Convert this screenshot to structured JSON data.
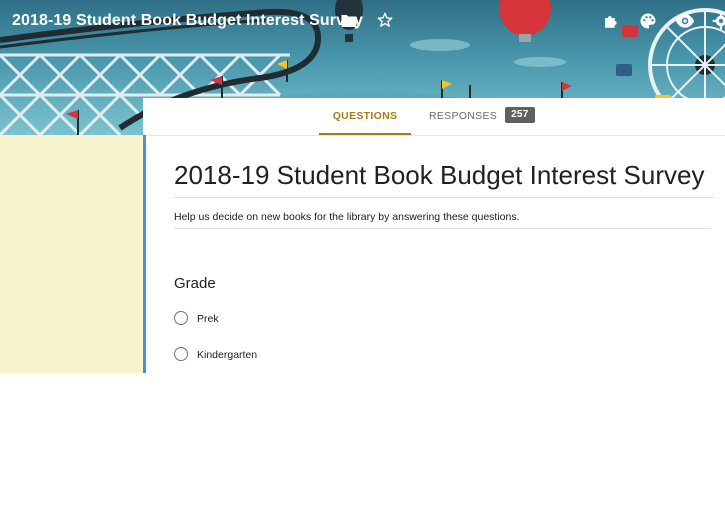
{
  "colors": {
    "accent": "#a87b12",
    "sidebar": "#f8f3cc",
    "left_border": "#4a8fd9",
    "badge": "#616161"
  },
  "header": {
    "title": "2018-19 Student Book Budget Interest Survey",
    "icons": [
      "folder-icon",
      "star-icon",
      "puzzle-icon",
      "palette-icon",
      "eye-icon",
      "gear-icon"
    ]
  },
  "tabs": {
    "questions_label": "QUESTIONS",
    "responses_label": "RESPONSES",
    "responses_count": "257"
  },
  "form": {
    "title": "2018-19 Student Book Budget Interest Survey",
    "description": "Help us decide on new books for the library by answering these questions.",
    "question": {
      "title": "Grade",
      "options": [
        {
          "label": "Prek"
        },
        {
          "label": "Kindergarten"
        }
      ]
    }
  }
}
